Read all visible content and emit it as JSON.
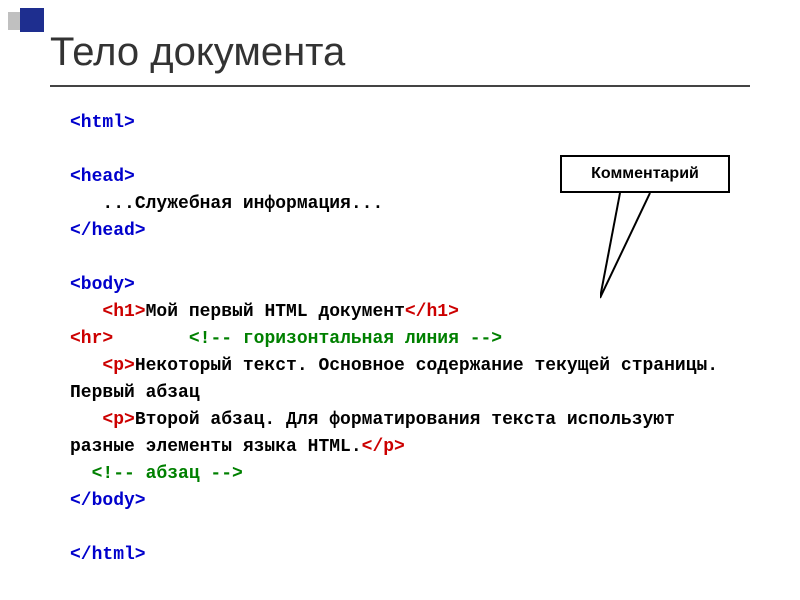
{
  "title": "Тело документа",
  "callout": {
    "label": "Комментарий"
  },
  "code": {
    "l1_html_open": "<html>",
    "l3_head_open": "<head>",
    "l4_indent": "   ...",
    "l4_text": "Служебная информация...",
    "l5_head_close": "</head>",
    "l7_body_open": "<body>",
    "l8_h1_open": "<h1>",
    "l8_text": "Мой первый HTML документ",
    "l8_h1_close": "</h1>",
    "l9_hr": "<hr>",
    "l9_comment": "<!-- горизонтальная линия -->",
    "l10_p_open": "<p>",
    "l10_text": "Некоторый текст. Основное содержание текущей страницы. Первый абзац",
    "l11_p_open": "<p>",
    "l11_text": "Второй абзац. Для форматирования текста используют разные элементы языка HTML.",
    "l11_p_close": "</p>",
    "l12_comment": "<!-- абзац -->",
    "l13_body_close": "</body>",
    "l15_html_close": "</html>"
  }
}
